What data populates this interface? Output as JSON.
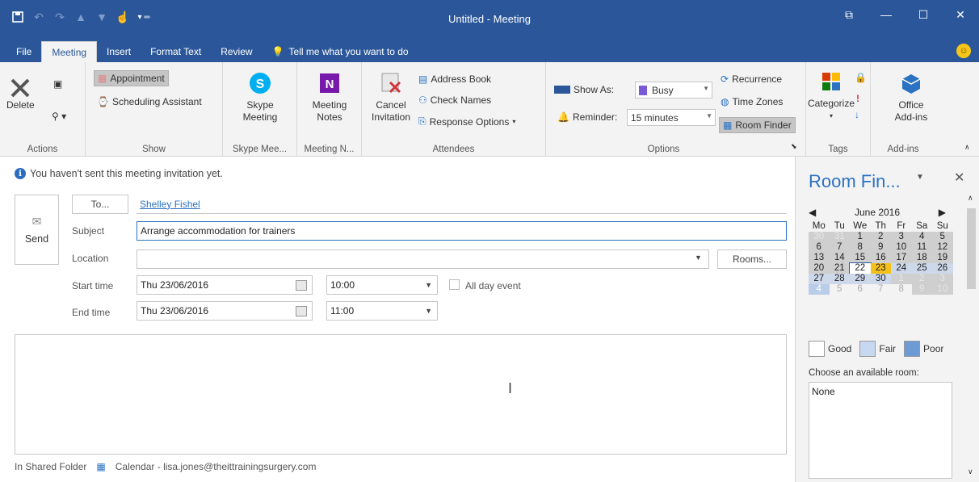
{
  "window": {
    "title": "Untitled - Meeting"
  },
  "tabs": [
    {
      "label": "File"
    },
    {
      "label": "Meeting"
    },
    {
      "label": "Insert"
    },
    {
      "label": "Format Text"
    },
    {
      "label": "Review"
    },
    {
      "label": "Tell me what you want to do"
    }
  ],
  "ribbon": {
    "actions": {
      "delete": "Delete",
      "label": "Actions"
    },
    "show": {
      "appointment": "Appointment",
      "scheduling": "Scheduling Assistant",
      "label": "Show"
    },
    "skype": {
      "line1": "Skype",
      "line2": "Meeting",
      "label": "Skype Mee..."
    },
    "notes": {
      "line1": "Meeting",
      "line2": "Notes",
      "label": "Meeting N..."
    },
    "attendees": {
      "cancel1": "Cancel",
      "cancel2": "Invitation",
      "address_book": "Address Book",
      "check_names": "Check Names",
      "response": "Response Options",
      "label": "Attendees"
    },
    "options": {
      "show_as_label": "Show As:",
      "show_as_value": "Busy",
      "reminder_label": "Reminder:",
      "reminder_value": "15 minutes",
      "recurrence": "Recurrence",
      "time_zones": "Time Zones",
      "room_finder": "Room Finder",
      "label": "Options"
    },
    "tags": {
      "categorize": "Categorize",
      "label": "Tags"
    },
    "addins": {
      "line1": "Office",
      "line2": "Add-ins",
      "label": "Add-ins"
    }
  },
  "form": {
    "info": "You haven't sent this meeting invitation yet.",
    "send": "Send",
    "to_button": "To...",
    "to_value": "Shelley Fishel",
    "subject_label": "Subject",
    "subject_value": "Arrange accommodation for trainers",
    "location_label": "Location",
    "location_value": "",
    "rooms_button": "Rooms...",
    "start_label": "Start time",
    "start_date": "Thu 23/06/2016",
    "start_time": "10:00",
    "all_day": "All day event",
    "end_label": "End time",
    "end_date": "Thu 23/06/2016",
    "end_time": "11:00",
    "status_folder": "In Shared Folder",
    "status_calendar": "Calendar - lisa.jones@theittrainingsurgery.com"
  },
  "room_finder": {
    "title": "Room Fin...",
    "month": "June 2016",
    "weekdays": [
      "Mo",
      "Tu",
      "We",
      "Th",
      "Fr",
      "Sa",
      "Su"
    ],
    "weeks": [
      [
        "30",
        "31",
        "1",
        "2",
        "3",
        "4",
        "5"
      ],
      [
        "6",
        "7",
        "8",
        "9",
        "10",
        "11",
        "12"
      ],
      [
        "13",
        "14",
        "15",
        "16",
        "17",
        "18",
        "19"
      ],
      [
        "20",
        "21",
        "22",
        "23",
        "24",
        "25",
        "26"
      ],
      [
        "27",
        "28",
        "29",
        "30",
        "1",
        "2",
        "3"
      ],
      [
        "4",
        "5",
        "6",
        "7",
        "8",
        "9",
        "10"
      ]
    ],
    "legend": {
      "good": "Good",
      "fair": "Fair",
      "poor": "Poor"
    },
    "choose_label": "Choose an available room:",
    "rooms": [
      "None"
    ]
  },
  "colors": {
    "accent": "#2b579a",
    "link": "#2b72c2",
    "today": "#f4c11a"
  }
}
